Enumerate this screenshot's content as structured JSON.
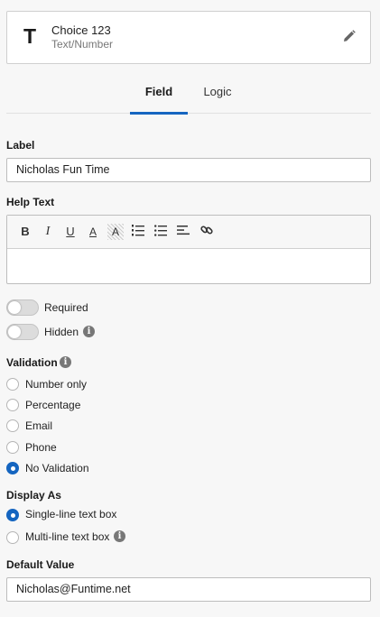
{
  "header": {
    "type_letter": "T",
    "title": "Choice 123",
    "subtitle": "Text/Number",
    "edit_icon": "pencil-icon"
  },
  "tabs": [
    {
      "label": "Field",
      "active": true
    },
    {
      "label": "Logic",
      "active": false
    }
  ],
  "label_section": {
    "heading": "Label",
    "value": "Nicholas Fun Time"
  },
  "help_text": {
    "heading": "Help Text",
    "toolbar": [
      "bold-icon",
      "italic-icon",
      "underline-icon",
      "font-color-icon",
      "highlight-icon",
      "numbered-list-icon",
      "bulleted-list-icon",
      "align-left-icon",
      "link-icon"
    ],
    "bold": "B",
    "italic": "I",
    "underline": "U",
    "font_color": "A",
    "highlight": "A",
    "value": ""
  },
  "toggles": {
    "required": {
      "label": "Required",
      "on": false
    },
    "hidden": {
      "label": "Hidden",
      "on": false
    }
  },
  "validation": {
    "heading": "Validation",
    "options": [
      "Number only",
      "Percentage",
      "Email",
      "Phone",
      "No Validation"
    ],
    "selected": "No Validation"
  },
  "display_as": {
    "heading": "Display As",
    "options": [
      "Single-line text box",
      "Multi-line text box"
    ],
    "selected": "Single-line text box"
  },
  "default_value": {
    "heading": "Default Value",
    "value": "Nicholas@Funtime.net"
  },
  "info_glyph": "i",
  "colors": {
    "accent": "#1565c0",
    "border": "#bdbdbd",
    "background": "#f7f7f7"
  }
}
